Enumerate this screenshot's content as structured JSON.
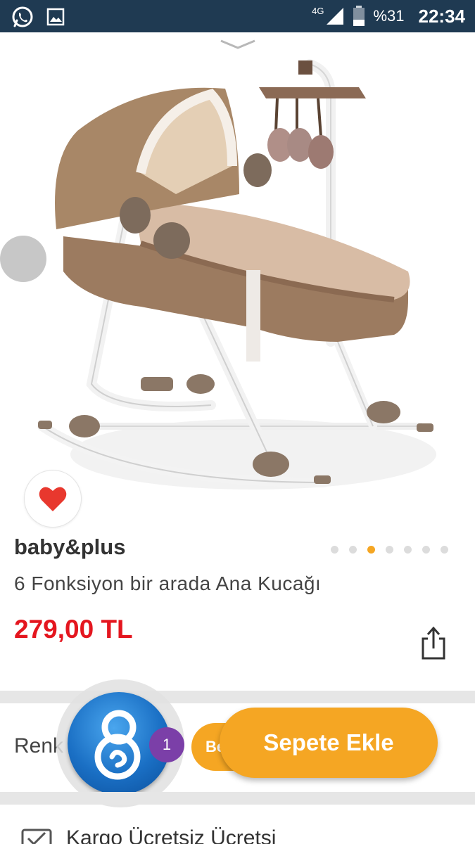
{
  "status_bar": {
    "network": "4G",
    "battery": "%31",
    "time": "22:34",
    "left_icons": [
      "whatsapp-icon",
      "gallery-icon"
    ]
  },
  "product": {
    "brand": "baby&plus",
    "name": "6 Fonksiyon bir arada Ana Kucağı",
    "price": "279,00 TL",
    "image_dots": {
      "count": 7,
      "active_index": 2
    },
    "favorite": true
  },
  "options": {
    "renk_label": "Renk",
    "be_button_label": "Be"
  },
  "cart": {
    "add_label": "Sepete Ekle"
  },
  "chat": {
    "badge_count": "1"
  },
  "shipping": {
    "label": "Kargo Ücretsiz Ücretsi"
  },
  "colors": {
    "status_bar": "#1f3a52",
    "accent_orange": "#f5a623",
    "price_red": "#e4161f",
    "badge_purple": "#7b3fa8",
    "chat_blue": "#1a6fc4",
    "heart_red": "#e8382e"
  }
}
